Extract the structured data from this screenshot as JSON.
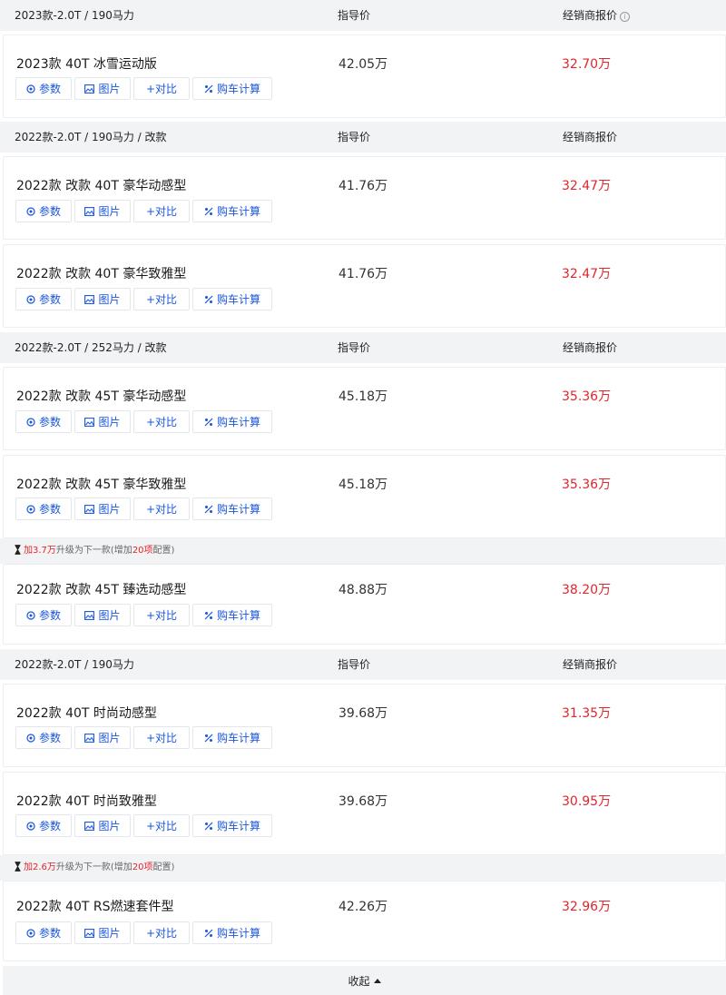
{
  "groups": [
    {
      "title": "2023款-2.0T / 190马力",
      "guide_label": "指导价",
      "dealer_label": "经销商报价",
      "show_info_icon": true
    },
    {
      "title": "2022款-2.0T / 190马力 / 改款",
      "guide_label": "指导价",
      "dealer_label": "经销商报价"
    },
    {
      "title": "2022款-2.0T / 252马力 / 改款",
      "guide_label": "指导价",
      "dealer_label": "经销商报价"
    },
    {
      "title": "2022款-2.0T / 190马力",
      "guide_label": "指导价",
      "dealer_label": "经销商报价"
    }
  ],
  "models": [
    {
      "name": "2023款 40T 冰雪运动版",
      "guide_price": "42.05万",
      "dealer_price": "32.70万"
    },
    {
      "name": "2022款 改款 40T 豪华动感型",
      "guide_price": "41.76万",
      "dealer_price": "32.47万"
    },
    {
      "name": "2022款 改款 40T 豪华致雅型",
      "guide_price": "41.76万",
      "dealer_price": "32.47万"
    },
    {
      "name": "2022款 改款 45T 豪华动感型",
      "guide_price": "45.18万",
      "dealer_price": "35.36万"
    },
    {
      "name": "2022款 改款 45T 豪华致雅型",
      "guide_price": "45.18万",
      "dealer_price": "35.36万"
    },
    {
      "name": "2022款 改款 45T 臻选动感型",
      "guide_price": "48.88万",
      "dealer_price": "38.20万"
    },
    {
      "name": "2022款 40T 时尚动感型",
      "guide_price": "39.68万",
      "dealer_price": "31.35万"
    },
    {
      "name": "2022款 40T 时尚致雅型",
      "guide_price": "39.68万",
      "dealer_price": "30.95万"
    },
    {
      "name": "2022款 40T RS燃速套件型",
      "guide_price": "42.26万",
      "dealer_price": "32.96万"
    }
  ],
  "buttons": {
    "params": "参数",
    "photos": "图片",
    "compare": "+对比",
    "calc": "购车计算"
  },
  "upgrade_tips": [
    {
      "prefix": "加",
      "amount": "3.7万",
      "middle": "升级为下一款(增加",
      "count": "20项",
      "suffix": "配置)"
    },
    {
      "prefix": "加",
      "amount": "2.6万",
      "middle": "升级为下一款(增加",
      "count": "20项",
      "suffix": "配置)"
    }
  ],
  "collapse_label": "收起",
  "colors": {
    "accent_blue": "#1a56db",
    "price_red": "#e0262b",
    "header_bg": "#f2f3f5"
  },
  "icons": [
    "info-icon",
    "params-icon",
    "image-icon",
    "calculator-icon",
    "hourglass-icon",
    "caret-up-icon"
  ]
}
